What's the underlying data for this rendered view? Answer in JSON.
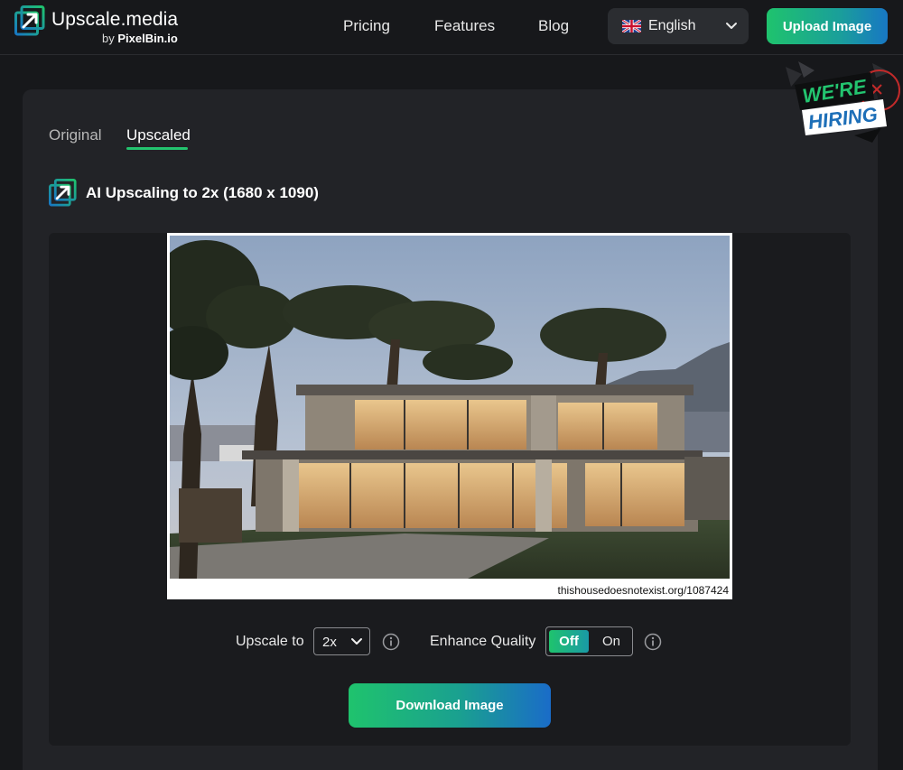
{
  "header": {
    "logo": {
      "name": "Upscale.media",
      "sub_prefix": "by ",
      "sub_brand": "PixelBin.io"
    },
    "nav": {
      "pricing": "Pricing",
      "features": "Features",
      "blog": "Blog"
    },
    "language": {
      "selected": "English"
    },
    "upload_label": "Upload Image"
  },
  "badge": {
    "line1": "WE'RE",
    "line2": "HIRING"
  },
  "tabs": {
    "original": "Original",
    "upscaled": "Upscaled",
    "active": "Upscaled"
  },
  "result": {
    "title": "AI Upscaling to 2x (1680 x 1090)",
    "watermark": "thishousedoesnotexist.org/1087424"
  },
  "controls": {
    "upscale_label": "Upscale to",
    "upscale_value": "2x",
    "enhance_label": "Enhance Quality",
    "enhance_off": "Off",
    "enhance_on": "On",
    "enhance_selected": "Off"
  },
  "download_label": "Download Image",
  "colors": {
    "accent_green": "#1fc36d",
    "accent_blue": "#1877c4",
    "background": "#17181b",
    "card": "#222327"
  }
}
